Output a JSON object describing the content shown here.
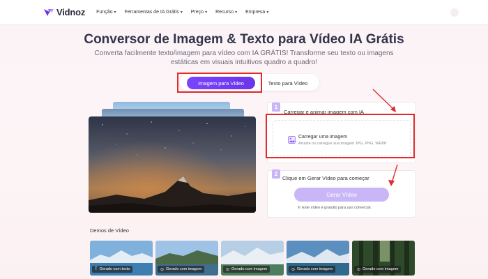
{
  "brand": {
    "name": "Vidnoz",
    "accent": "#7b45ff"
  },
  "nav": {
    "items": [
      {
        "label": "Função"
      },
      {
        "label": "Ferramentas de IA Grátis"
      },
      {
        "label": "Preço"
      },
      {
        "label": "Recurso"
      },
      {
        "label": "Empresa"
      }
    ]
  },
  "hero": {
    "title": "Conversor de Imagem & Texto para Vídeo IA Grátis",
    "subtitle": "Converta facilmente texto/imagem para vídeo com IA GRÁTIS! Transforme seu texto ou imagens estáticas em visuais intuitivos quadro a quadro!"
  },
  "tabs": {
    "active": "Imagem para Vídeo",
    "inactive": "Texto para Vídeo"
  },
  "step1": {
    "number": "1",
    "label": "Carregar e animar imagem com IA",
    "upload_title": "Carregar uma imagem",
    "upload_hint": "Arraste ou carregue sua imagem JPG, PNG, WEBP"
  },
  "step2": {
    "number": "2",
    "label": "Clique em Gerar Vídeo para começar",
    "button": "Gerar Vídeo",
    "note": "Este vídeo é gratuito para uso comercial."
  },
  "demos": {
    "title": "Demos de Vídeo",
    "cards": [
      {
        "label": "Gerado com texto",
        "icon": "text-icon"
      },
      {
        "label": "Gerado com imagem",
        "icon": "image-icon"
      },
      {
        "label": "Gerado com imagem",
        "icon": "image-icon"
      },
      {
        "label": "Gerado com imagem",
        "icon": "image-icon"
      },
      {
        "label": "Gerado com imagem",
        "icon": "image-icon"
      }
    ]
  },
  "colors": {
    "highlight": "#e02b2b",
    "button_disabled": "#c8b6f6",
    "badge": "#c9b4f5"
  }
}
